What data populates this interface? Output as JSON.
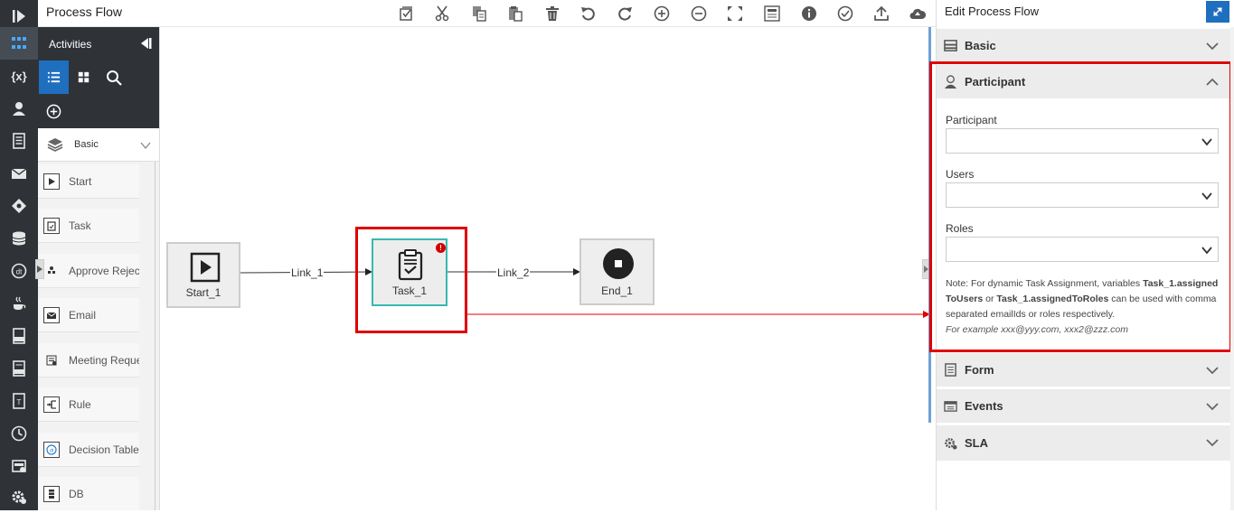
{
  "app": {
    "title": "Process Flow"
  },
  "rail": {
    "items": [
      {
        "name": "rail-collapse-icon",
        "glyph": "collapse"
      },
      {
        "name": "process-flow-icon",
        "glyph": "flow"
      },
      {
        "name": "variables-icon",
        "glyph": "{x}"
      },
      {
        "name": "participant-icon",
        "glyph": "person"
      },
      {
        "name": "form-icon",
        "glyph": "doc"
      },
      {
        "name": "email-icon",
        "glyph": "mail"
      },
      {
        "name": "rule-icon",
        "glyph": "diamond"
      },
      {
        "name": "database-icon",
        "glyph": "db"
      },
      {
        "name": "decision-table-icon",
        "glyph": "dt"
      },
      {
        "name": "java-icon",
        "glyph": "cup"
      },
      {
        "name": "script-icon",
        "glyph": "js"
      },
      {
        "name": "css-icon",
        "glyph": "css"
      },
      {
        "name": "template-icon",
        "glyph": "t"
      },
      {
        "name": "timer-icon",
        "glyph": "clock"
      },
      {
        "name": "report-icon",
        "glyph": "report"
      },
      {
        "name": "settings-icon",
        "glyph": "gear"
      }
    ]
  },
  "activities": {
    "header": "Activities",
    "category": "Basic",
    "items": [
      {
        "label": "Start",
        "icon": "start-icon"
      },
      {
        "label": "Task",
        "icon": "task-icon"
      },
      {
        "label": "Approve Reject",
        "icon": "approve-reject-icon"
      },
      {
        "label": "Email",
        "icon": "email-icon"
      },
      {
        "label": "Meeting Request",
        "icon": "meeting-request-icon"
      },
      {
        "label": "Rule",
        "icon": "rule-icon"
      },
      {
        "label": "Decision Table",
        "icon": "decision-table-icon"
      },
      {
        "label": "DB",
        "icon": "db-icon"
      }
    ]
  },
  "toolbar": {
    "buttons": [
      "select-all",
      "cut",
      "copy",
      "paste",
      "delete",
      "undo",
      "redo",
      "zoom-in",
      "zoom-out",
      "fit-screen",
      "grid",
      "info",
      "validate",
      "publish",
      "cloud"
    ]
  },
  "diagram": {
    "nodes": {
      "start": "Start_1",
      "task": "Task_1",
      "end": "End_1"
    },
    "links": {
      "link1": "Link_1",
      "link2": "Link_2"
    },
    "task_error_badge": "!"
  },
  "panel": {
    "title": "Edit Process Flow",
    "sections": {
      "basic": "Basic",
      "participant": "Participant",
      "form": "Form",
      "events": "Events",
      "sla": "SLA"
    },
    "participant": {
      "participant_label": "Participant",
      "users_label": "Users",
      "roles_label": "Roles",
      "participant_value": "",
      "users_value": "",
      "roles_value": "",
      "note_prefix": "Note: For dynamic Task Assignment, variables ",
      "note_var1": "Task_1.assignedToUsers",
      "note_mid": " or ",
      "note_var2": "Task_1.assignedToRoles",
      "note_suffix": " can be used with comma separated emailIds or roles respectively.",
      "note_example": "For example xxx@yyy.com, xxx2@zzz.com"
    }
  },
  "colors": {
    "rail_bg": "#2f3338",
    "accent": "#1f6fbf",
    "task_border": "#37b9ae",
    "highlight": "#e00000"
  }
}
